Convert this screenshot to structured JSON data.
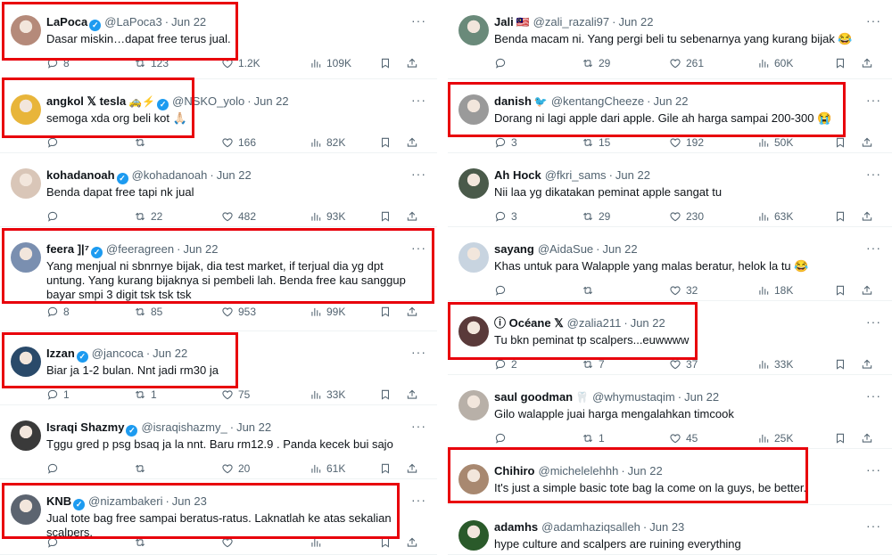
{
  "left": [
    {
      "name": "LaPoca",
      "verified": true,
      "emoji": "",
      "handle": "@LaPoca3",
      "date": "Jun 22",
      "text": "Dasar miskin…dapat free terus jual.",
      "replies": "8",
      "retweets": "123",
      "likes": "1.2K",
      "views": "109K",
      "avatar_color": "#b58a7a"
    },
    {
      "name": "angkol 𝕏 tesla",
      "verified": true,
      "emoji": "🚕⚡",
      "handle": "@NSKO_yolo",
      "date": "Jun 22",
      "text": "semoga xda org beli kot 🙏🏻",
      "replies": "",
      "retweets": "",
      "likes": "166",
      "views": "82K",
      "avatar_color": "#e8b53a"
    },
    {
      "name": "kohadanoah",
      "verified": true,
      "emoji": "",
      "handle": "@kohadanoah",
      "date": "Jun 22",
      "text": "Benda dapat free tapi nk jual",
      "replies": "",
      "retweets": "22",
      "likes": "482",
      "views": "93K",
      "avatar_color": "#d9c6b8"
    },
    {
      "name": "feera ]|⁷",
      "verified": true,
      "emoji": "",
      "handle": "@feeragreen",
      "date": "Jun 22",
      "text": "Yang menjual ni sbnrnye bijak, dia test market, if terjual dia yg dpt untung. Yang kurang bijaknya si pembeli lah. Benda free kau sanggup bayar smpi 3 digit tsk tsk tsk",
      "replies": "8",
      "retweets": "85",
      "likes": "953",
      "views": "99K",
      "avatar_color": "#7a8fb0"
    },
    {
      "name": "Izzan",
      "verified": true,
      "emoji": "",
      "handle": "@jancoca",
      "date": "Jun 22",
      "text": "Biar ja 1-2 bulan. Nnt jadi rm30 ja",
      "replies": "1",
      "retweets": "1",
      "likes": "75",
      "views": "33K",
      "avatar_color": "#2a4a6a"
    },
    {
      "name": "Israqi Shazmy",
      "verified": true,
      "emoji": "",
      "handle": "@israqishazmy_",
      "date": "Jun 22",
      "text": "Tggu gred p psg bsaq ja la nnt. Baru rm12.9 . Panda kecek bui sajo",
      "replies": "",
      "retweets": "",
      "likes": "20",
      "views": "61K",
      "avatar_color": "#3a3a3a"
    },
    {
      "name": "KNB",
      "verified": true,
      "emoji": "",
      "handle": "@nizambakeri",
      "date": "Jun 23",
      "text": "Jual tote bag free sampai beratus-ratus. Laknatlah ke atas sekalian scalpers.",
      "replies": "",
      "retweets": "",
      "likes": "",
      "views": "",
      "avatar_color": "#5c6470"
    }
  ],
  "right": [
    {
      "name": "Jali",
      "verified": false,
      "emoji": "🇲🇾",
      "handle": "@zali_razali97",
      "date": "Jun 22",
      "text": "Benda macam ni. Yang pergi beli tu sebenarnya yang kurang bijak 😂",
      "replies": "",
      "retweets": "29",
      "likes": "261",
      "views": "60K",
      "avatar_color": "#6a8a7a"
    },
    {
      "name": "danish",
      "verified": false,
      "emoji": "🐦",
      "handle": "@kentangCheeze",
      "date": "Jun 22",
      "text": "Dorang ni lagi apple dari apple. Gile ah harga sampai 200-300 😭",
      "replies": "3",
      "retweets": "15",
      "likes": "192",
      "views": "50K",
      "avatar_color": "#9a9a9a"
    },
    {
      "name": "Ah Hock",
      "verified": false,
      "emoji": "",
      "handle": "@fkri_sams",
      "date": "Jun 22",
      "text": "Nii laa yg dikatakan peminat apple sangat tu",
      "replies": "3",
      "retweets": "29",
      "likes": "230",
      "views": "63K",
      "avatar_color": "#4a5a4a"
    },
    {
      "name": "sayang",
      "verified": false,
      "emoji": "",
      "handle": "@AidaSue",
      "date": "Jun 22",
      "text": "Khas untuk para Walapple yang malas beratur, helok la tu 😂",
      "replies": "",
      "retweets": "",
      "likes": "32",
      "views": "18K",
      "avatar_color": "#c8d4e0"
    },
    {
      "name": "ⓘ Océane 𝕏",
      "verified": false,
      "emoji": "",
      "handle": "@zalia211",
      "date": "Jun 22",
      "text": "Tu bkn peminat tp scalpers...euwwww",
      "replies": "2",
      "retweets": "7",
      "likes": "37",
      "views": "33K",
      "avatar_color": "#5a3a3a"
    },
    {
      "name": "saul goodman",
      "verified": false,
      "emoji": "🦷",
      "handle": "@whymustaqim",
      "date": "Jun 22",
      "text": "Gilo walapple juai harga mengalahkan timcook",
      "replies": "",
      "retweets": "1",
      "likes": "45",
      "views": "25K",
      "avatar_color": "#b8b0a8"
    },
    {
      "name": "Chihiro",
      "verified": false,
      "emoji": "",
      "handle": "@michelelehhh",
      "date": "Jun 22",
      "text": "It's just a simple basic tote bag la come on la guys, be better.",
      "replies": "",
      "retweets": "",
      "likes": "",
      "views": "",
      "avatar_color": "#a88870"
    },
    {
      "name": "adamhs",
      "verified": false,
      "emoji": "",
      "handle": "@adamhaziqsalleh",
      "date": "Jun 23",
      "text": "hype culture and scalpers are ruining everything",
      "replies": "",
      "retweets": "",
      "likes": "",
      "views": "",
      "avatar_color": "#2a5a2a"
    }
  ],
  "icons": {
    "verified": "verified-badge-icon",
    "more": "more-icon",
    "reply": "reply-icon",
    "retweet": "retweet-icon",
    "like": "like-icon",
    "views": "views-icon",
    "bookmark": "bookmark-icon",
    "share": "share-icon"
  },
  "highlight_color": "#e8000b",
  "more_glyph": "···",
  "verified_glyph": "✓"
}
